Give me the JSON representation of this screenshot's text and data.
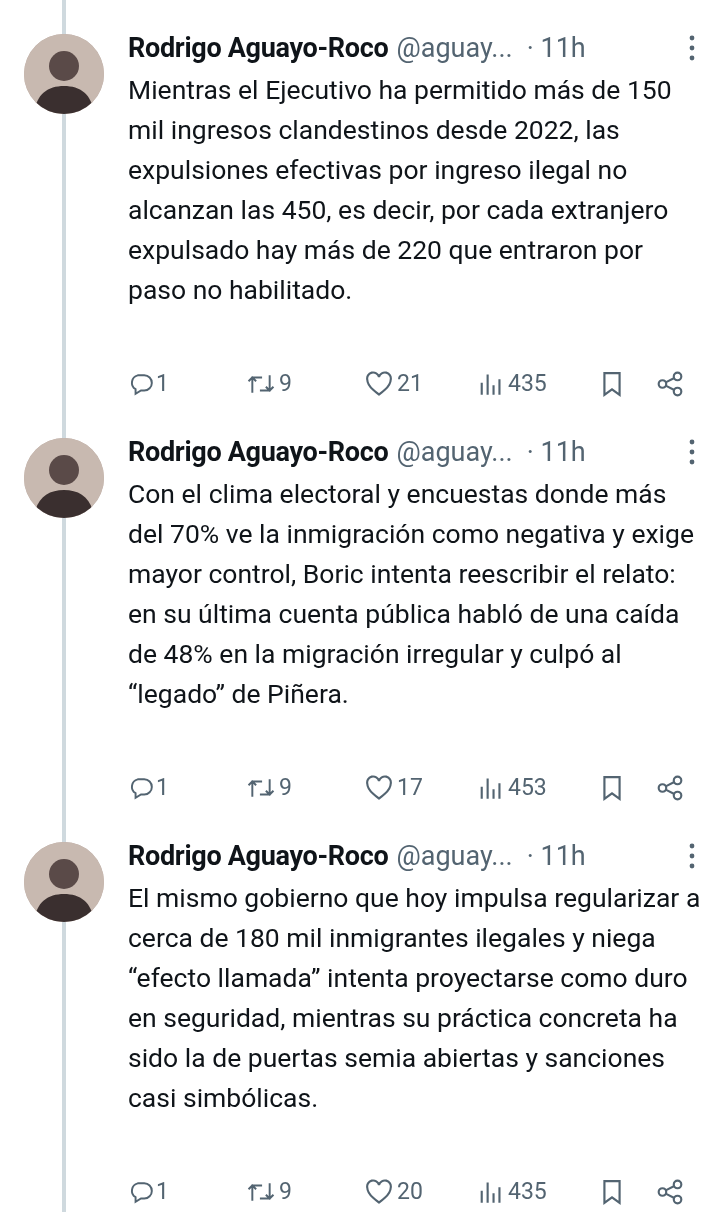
{
  "tweets": [
    {
      "author": "Rodrigo Aguayo-Roco",
      "handle": "@aguay...",
      "time": "· 11h",
      "text": "Mientras el Ejecutivo ha permitido más de 150 mil ingresos clandestinos desde 2022, las expulsiones efectivas por ingreso ilegal no alcanzan las 450, es decir, por cada extranjero expulsado hay más de 220 que entraron por paso no habilitado.",
      "replies": "1",
      "reposts": "9",
      "likes": "21",
      "views": "435"
    },
    {
      "author": "Rodrigo Aguayo-Roco",
      "handle": "@aguay...",
      "time": "· 11h",
      "text": "Con el clima electoral y encuestas donde más del 70% ve la inmigración como negativa y exige mayor control, Boric intenta reescribir el relato: en su última cuenta pública habló de una caída de 48% en la migración irregular y culpó al “legado” de Piñera.",
      "replies": "1",
      "reposts": "9",
      "likes": "17",
      "views": "453"
    },
    {
      "author": "Rodrigo Aguayo-Roco",
      "handle": "@aguay...",
      "time": "· 11h",
      "text": "El mismo gobierno que hoy impulsa regularizar a cerca de 180 mil inmigrantes ilegales y niega “efecto llamada” intenta proyectarse como duro en seguridad, mientras su práctica concreta ha sido la de puertas semia abiertas y sanciones casi simbólicas.",
      "replies": "1",
      "reposts": "9",
      "likes": "20",
      "views": "435"
    }
  ]
}
